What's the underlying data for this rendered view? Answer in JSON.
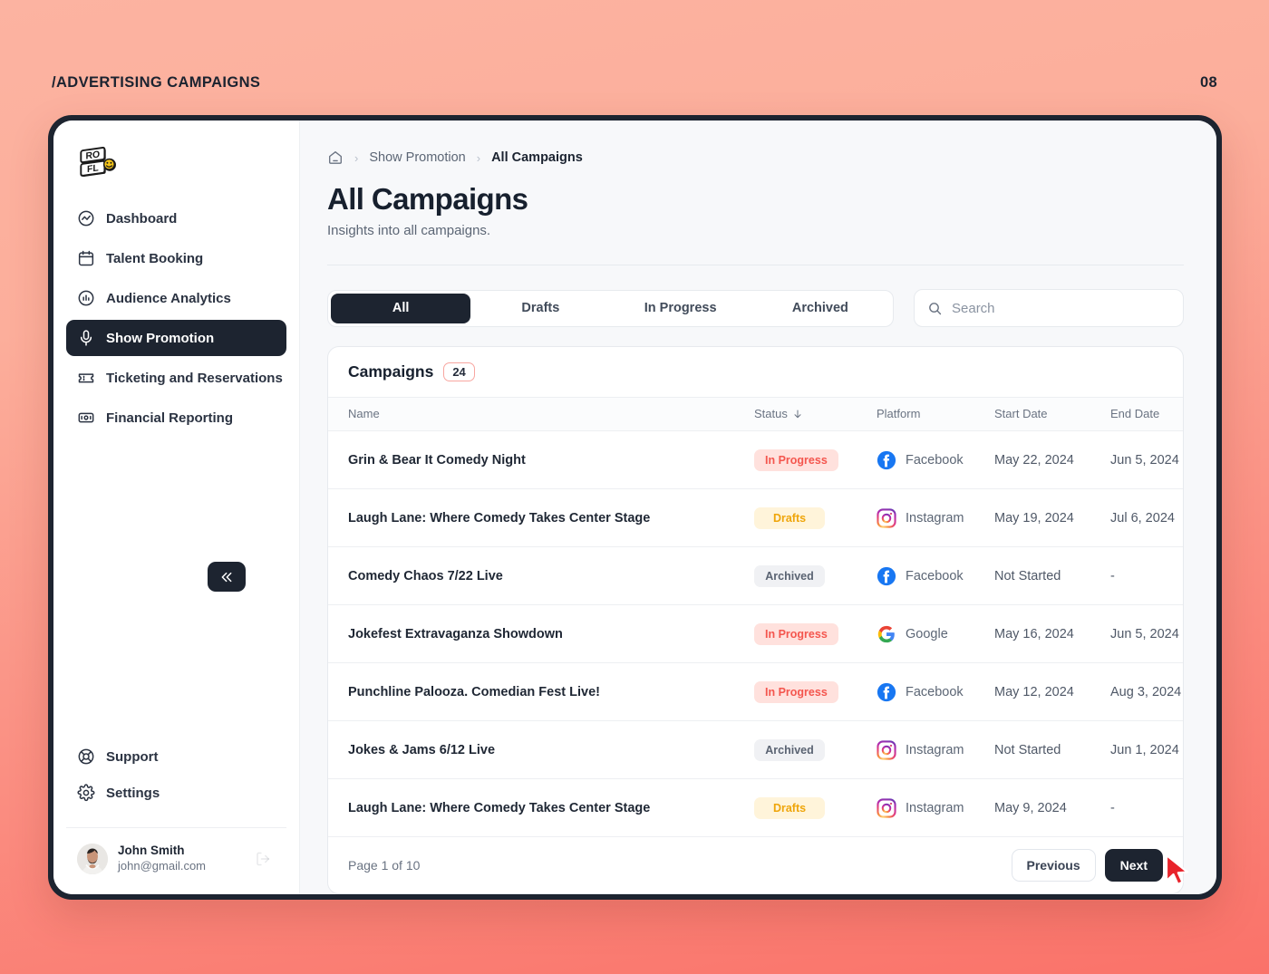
{
  "page": {
    "label": "/ADVERTISING CAMPAIGNS",
    "number": "08"
  },
  "colors": {
    "accent_dark": "#1D2430",
    "badge_inprogress_bg": "#FFE1DD",
    "badge_inprogress_text": "#F4564E",
    "badge_drafts_bg": "#FFF4DA",
    "badge_drafts_text": "#EFA50A",
    "badge_archived_bg": "#F0F1F4",
    "badge_archived_text": "#5A6372",
    "count_badge_border": "#F8A6A0",
    "background_top": "#FCB3A1",
    "background_bottom": "#FA7269",
    "cursor": "#E8232B"
  },
  "sidebar": {
    "logo_text": "ROFL",
    "items": [
      {
        "label": "Dashboard",
        "icon": "activity-icon",
        "active": false
      },
      {
        "label": "Talent Booking",
        "icon": "calendar-icon",
        "active": false
      },
      {
        "label": "Audience Analytics",
        "icon": "chart-circle-icon",
        "active": false
      },
      {
        "label": "Show Promotion",
        "icon": "microphone-icon",
        "active": true
      },
      {
        "label": "Ticketing and Reservations",
        "icon": "ticket-icon",
        "active": false
      },
      {
        "label": "Financial Reporting",
        "icon": "receipt-icon",
        "active": false
      }
    ],
    "collapse_icon": "chevrons-left-icon",
    "bottom_items": [
      {
        "label": "Support",
        "icon": "lifebuoy-icon"
      },
      {
        "label": "Settings",
        "icon": "gear-icon"
      }
    ],
    "user": {
      "name": "John Smith",
      "email": "john@gmail.com",
      "avatar": "user-avatar",
      "logout_icon": "logout-icon"
    }
  },
  "breadcrumb": {
    "home_icon": "home-icon",
    "separator": "›",
    "items": [
      {
        "label": "Show Promotion",
        "current": false
      },
      {
        "label": "All Campaigns",
        "current": true
      }
    ]
  },
  "header": {
    "title": "All Campaigns",
    "subtitle": "Insights into all campaigns."
  },
  "tabs": [
    {
      "label": "All",
      "active": true
    },
    {
      "label": "Drafts",
      "active": false
    },
    {
      "label": "In Progress",
      "active": false
    },
    {
      "label": "Archived",
      "active": false
    }
  ],
  "search": {
    "placeholder": "Search",
    "value": "",
    "icon": "search-icon"
  },
  "table": {
    "section_title": "Campaigns",
    "count": "24",
    "sort_icon": "arrow-down-icon",
    "columns": [
      "Name",
      "Status",
      "Platform",
      "Start Date",
      "End Date"
    ],
    "rows": [
      {
        "name": "Grin & Bear It Comedy Night",
        "status": "In Progress",
        "status_key": "inprogress",
        "platform": "Facebook",
        "platform_icon": "facebook-icon",
        "start_date": "May 22, 2024",
        "end_date": "Jun 5, 2024"
      },
      {
        "name": "Laugh Lane: Where Comedy Takes Center Stage",
        "status": "Drafts",
        "status_key": "drafts",
        "platform": "Instagram",
        "platform_icon": "instagram-icon",
        "start_date": "May 19, 2024",
        "end_date": "Jul 6, 2024"
      },
      {
        "name": "Comedy Chaos 7/22 Live",
        "status": "Archived",
        "status_key": "archived",
        "platform": "Facebook",
        "platform_icon": "facebook-icon",
        "start_date": "Not Started",
        "end_date": "-"
      },
      {
        "name": "Jokefest Extravaganza Showdown",
        "status": "In Progress",
        "status_key": "inprogress",
        "platform": "Google",
        "platform_icon": "google-icon",
        "start_date": "May 16, 2024",
        "end_date": "Jun 5, 2024"
      },
      {
        "name": "Punchline Palooza. Comedian Fest Live!",
        "status": "In Progress",
        "status_key": "inprogress",
        "platform": "Facebook",
        "platform_icon": "facebook-icon",
        "start_date": "May 12, 2024",
        "end_date": "Aug 3, 2024"
      },
      {
        "name": "Jokes & Jams 6/12 Live",
        "status": "Archived",
        "status_key": "archived",
        "platform": "Instagram",
        "platform_icon": "instagram-icon",
        "start_date": "Not Started",
        "end_date": "Jun 1, 2024"
      },
      {
        "name": "Laugh Lane: Where Comedy Takes Center Stage",
        "status": "Drafts",
        "status_key": "drafts",
        "platform": "Instagram",
        "platform_icon": "instagram-icon",
        "start_date": "May 9, 2024",
        "end_date": "-"
      }
    ]
  },
  "pagination": {
    "info": "Page 1 of 10",
    "previous_label": "Previous",
    "next_label": "Next"
  }
}
